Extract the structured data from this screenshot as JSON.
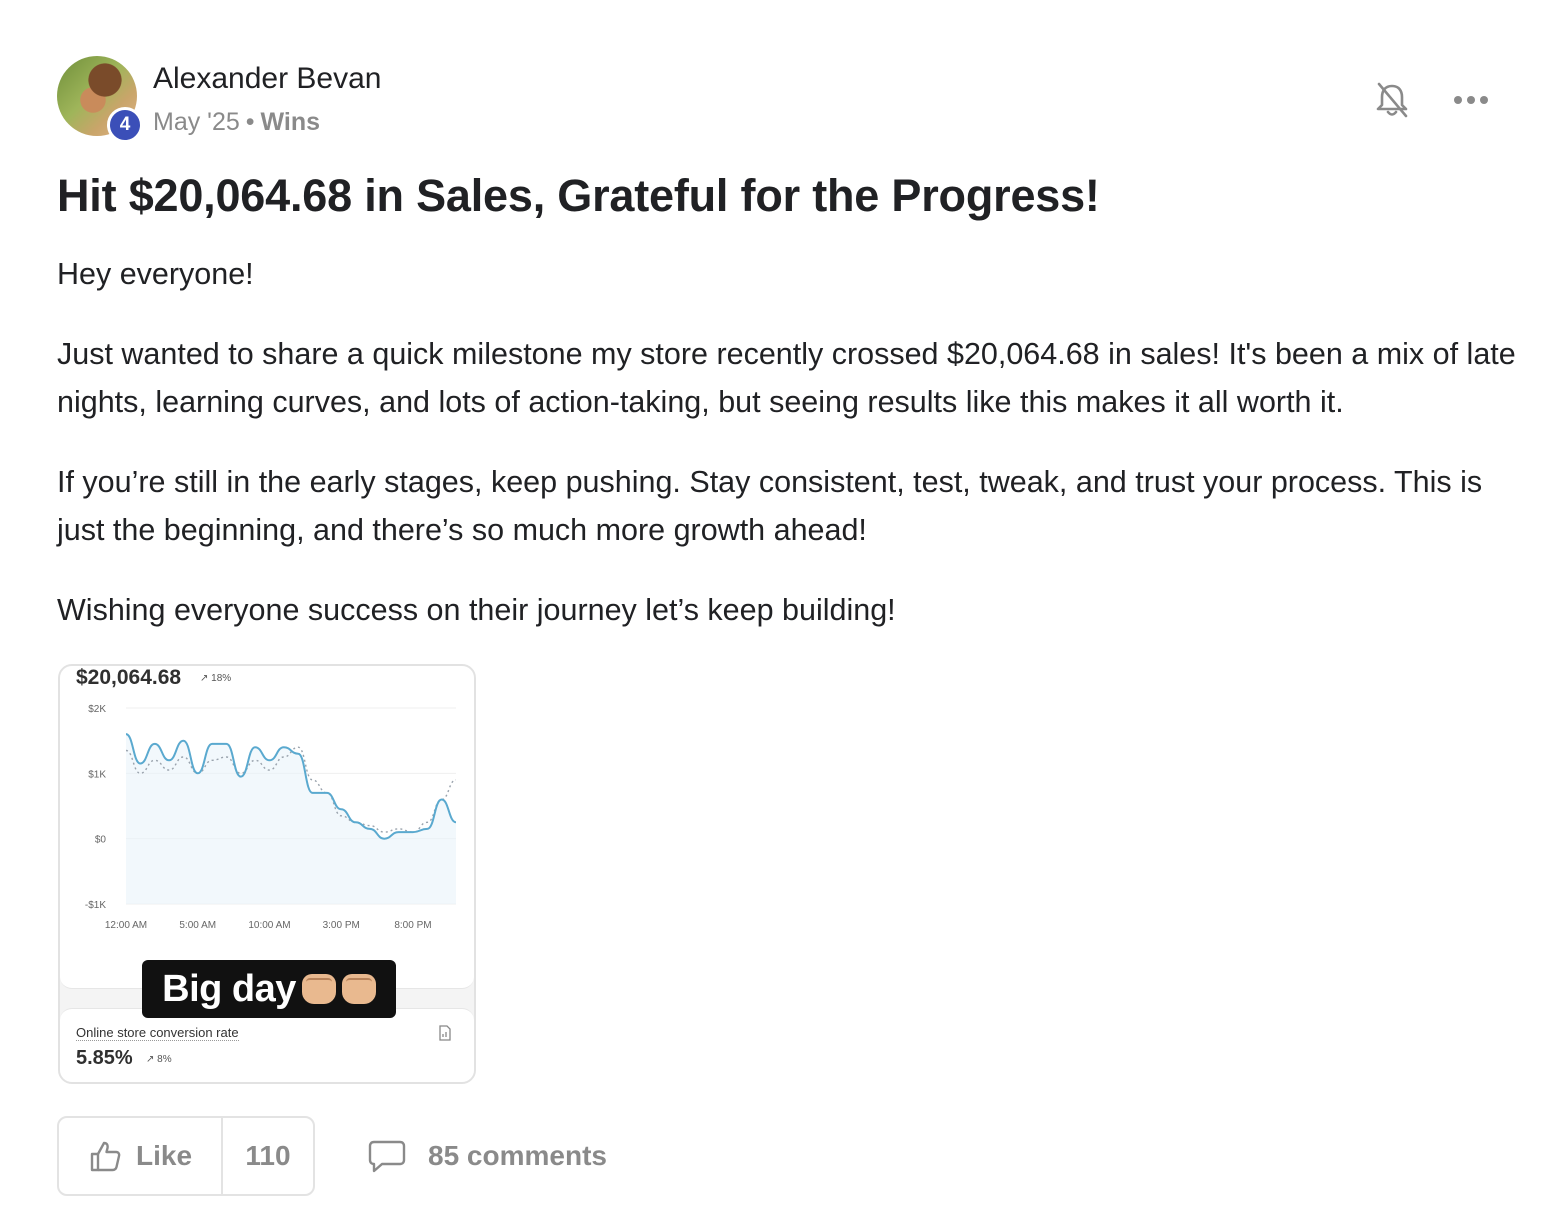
{
  "post": {
    "author": {
      "name": "Alexander Bevan",
      "level": "4"
    },
    "date": "May '25",
    "separator": "•",
    "category": "Wins",
    "title": "Hit $20,064.68 in Sales, Grateful for the Progress!",
    "paragraphs": [
      "Hey everyone!",
      "Just wanted to share a quick milestone my store recently crossed $20,064.68 in sales! It's been a mix of late nights, learning curves, and lots of action-taking, but seeing results like this makes it all worth it.",
      "If you’re still in the early stages, keep pushing. Stay consistent, test, tweak, and trust your process. This is just the beginning, and there’s so much more growth ahead!",
      "Wishing everyone success on their journey let’s keep building!"
    ]
  },
  "attachment": {
    "total_sales": "$20,064.68",
    "total_change": "↗ 18%",
    "overlay_caption": "Big day",
    "overlay_emoji": "fist-bump",
    "conversion_label": "Online store conversion rate",
    "conversion_value": "5.85%",
    "conversion_change": "↗ 8%",
    "chart_data": {
      "type": "line",
      "title": "",
      "xlabel": "",
      "ylabel": "",
      "ylim": [
        -1000,
        2000
      ],
      "yticks": [
        "$2K",
        "$1K",
        "$0",
        "-$1K"
      ],
      "ytick_values": [
        2000,
        1000,
        0,
        -1000
      ],
      "xticks": [
        "12:00 AM",
        "5:00 AM",
        "10:00 AM",
        "3:00 PM",
        "8:00 PM"
      ],
      "x_hours": [
        0,
        1,
        2,
        3,
        4,
        5,
        6,
        7,
        8,
        9,
        10,
        11,
        12,
        13,
        14,
        15,
        16,
        17,
        18,
        19,
        20,
        21,
        22,
        23
      ],
      "series": [
        {
          "style": "solid",
          "color": "#5aa9cf",
          "values": [
            1600,
            1150,
            1450,
            1200,
            1500,
            1000,
            1450,
            1450,
            950,
            1400,
            1200,
            1400,
            1300,
            700,
            700,
            450,
            250,
            150,
            0,
            100,
            100,
            150,
            600,
            250
          ]
        },
        {
          "style": "dotted",
          "color": "#9aa3ad",
          "values": [
            1350,
            1000,
            1200,
            1050,
            1250,
            1000,
            1200,
            1250,
            1000,
            1200,
            1050,
            1250,
            1400,
            900,
            700,
            350,
            250,
            200,
            100,
            150,
            100,
            250,
            600,
            900
          ]
        }
      ]
    }
  },
  "actions": {
    "like_label": "Like",
    "like_count": "110",
    "comments_label": "85 comments"
  },
  "colors": {
    "badge": "#3b4fb8",
    "muted_text": "#8a8a8a",
    "line": "#5aa9cf"
  },
  "icons": {
    "notifications": "bell-off-icon",
    "more": "ellipsis-icon",
    "like": "thumbs-up-icon",
    "comments": "comment-bubble-icon"
  }
}
